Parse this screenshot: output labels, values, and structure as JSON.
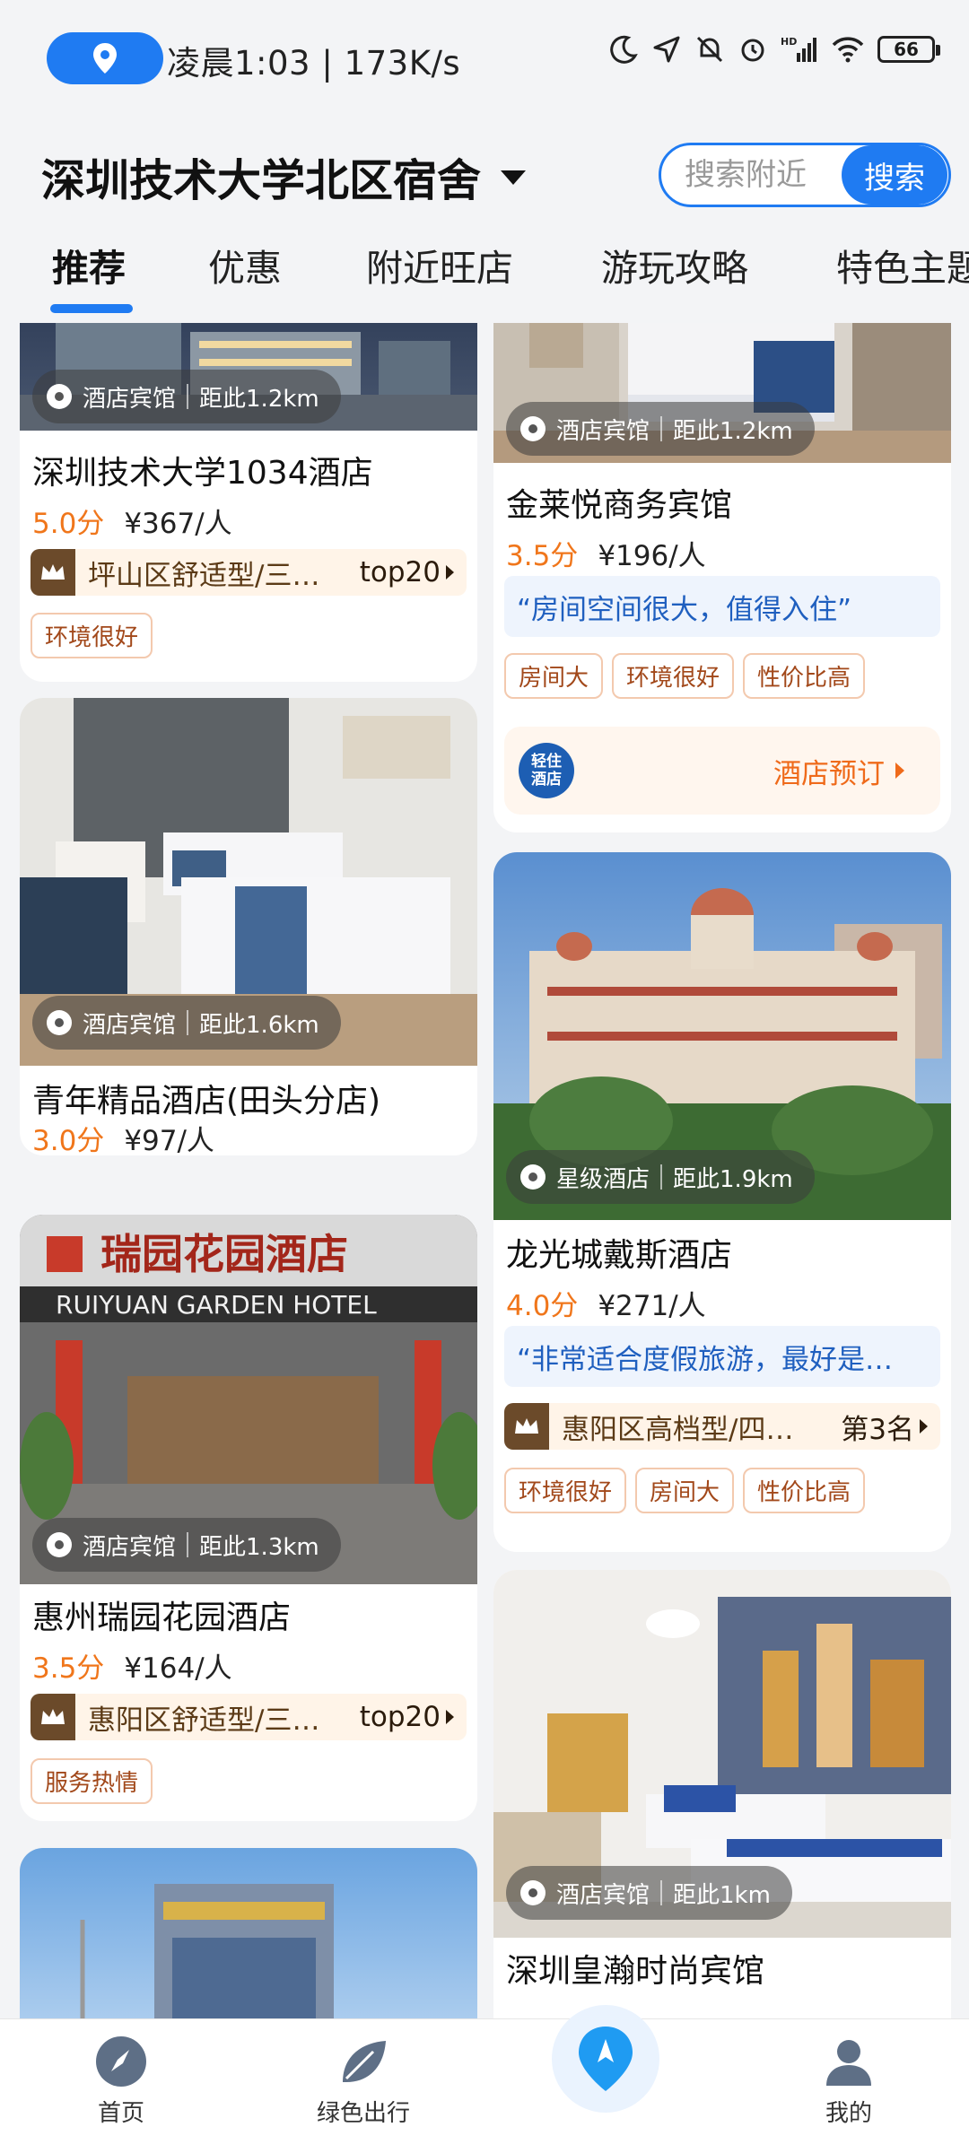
{
  "status_bar": {
    "time_speed": "凌晨1:03 | 173K/s",
    "battery": "66"
  },
  "header": {
    "location": "深圳技术大学北区宿舍",
    "search_placeholder": "搜索附近",
    "search_button": "搜索"
  },
  "tabs": [
    "推荐",
    "优惠",
    "附近旺店",
    "游玩攻略",
    "特色主题"
  ],
  "cards": {
    "c1": {
      "category": "酒店宾馆",
      "distance": "距此1.2km",
      "name": "深圳技术大学1034酒店",
      "score": "5.0分",
      "price": "¥367/人",
      "rank_text": "坪山区舒适型/三…",
      "rank_pos": "top20",
      "tags": [
        "环境很好"
      ]
    },
    "c2": {
      "category": "酒店宾馆",
      "distance": "距此1.2km",
      "name": "金莱悦商务宾馆",
      "score": "3.5分",
      "price": "¥196/人",
      "quote": "“房间空间很大，值得入住”",
      "tags": [
        "房间大",
        "环境很好",
        "性价比高"
      ],
      "brand_logo": "轻住\n酒店",
      "book_label": "酒店预订"
    },
    "c3": {
      "category": "酒店宾馆",
      "distance": "距此1.6km",
      "name": "青年精品酒店(田头分店)",
      "score": "3.0分",
      "price": "¥97/人"
    },
    "c4": {
      "category": "星级酒店",
      "distance": "距此1.9km",
      "name": "龙光城戴斯酒店",
      "score": "4.0分",
      "price": "¥271/人",
      "quote": "“非常适合度假旅游，最好是…",
      "rank_text": "惠阳区高档型/四…",
      "rank_pos": "第3名",
      "tags": [
        "环境很好",
        "房间大",
        "性价比高"
      ]
    },
    "c5": {
      "category": "酒店宾馆",
      "distance": "距此1.3km",
      "name": "惠州瑞园花园酒店",
      "score": "3.5分",
      "price": "¥164/人",
      "rank_text": "惠阳区舒适型/三…",
      "rank_pos": "top20",
      "tags": [
        "服务热情"
      ],
      "sign_cn": "瑞园花园酒店",
      "sign_en": "RUIYUAN GARDEN HOTEL"
    },
    "c6": {
      "category": "酒店宾馆",
      "distance": "距此1km",
      "name": "深圳皇瀚时尚宾馆"
    }
  },
  "bottom_nav": {
    "home": "首页",
    "green": "绿色出行",
    "mine": "我的"
  }
}
